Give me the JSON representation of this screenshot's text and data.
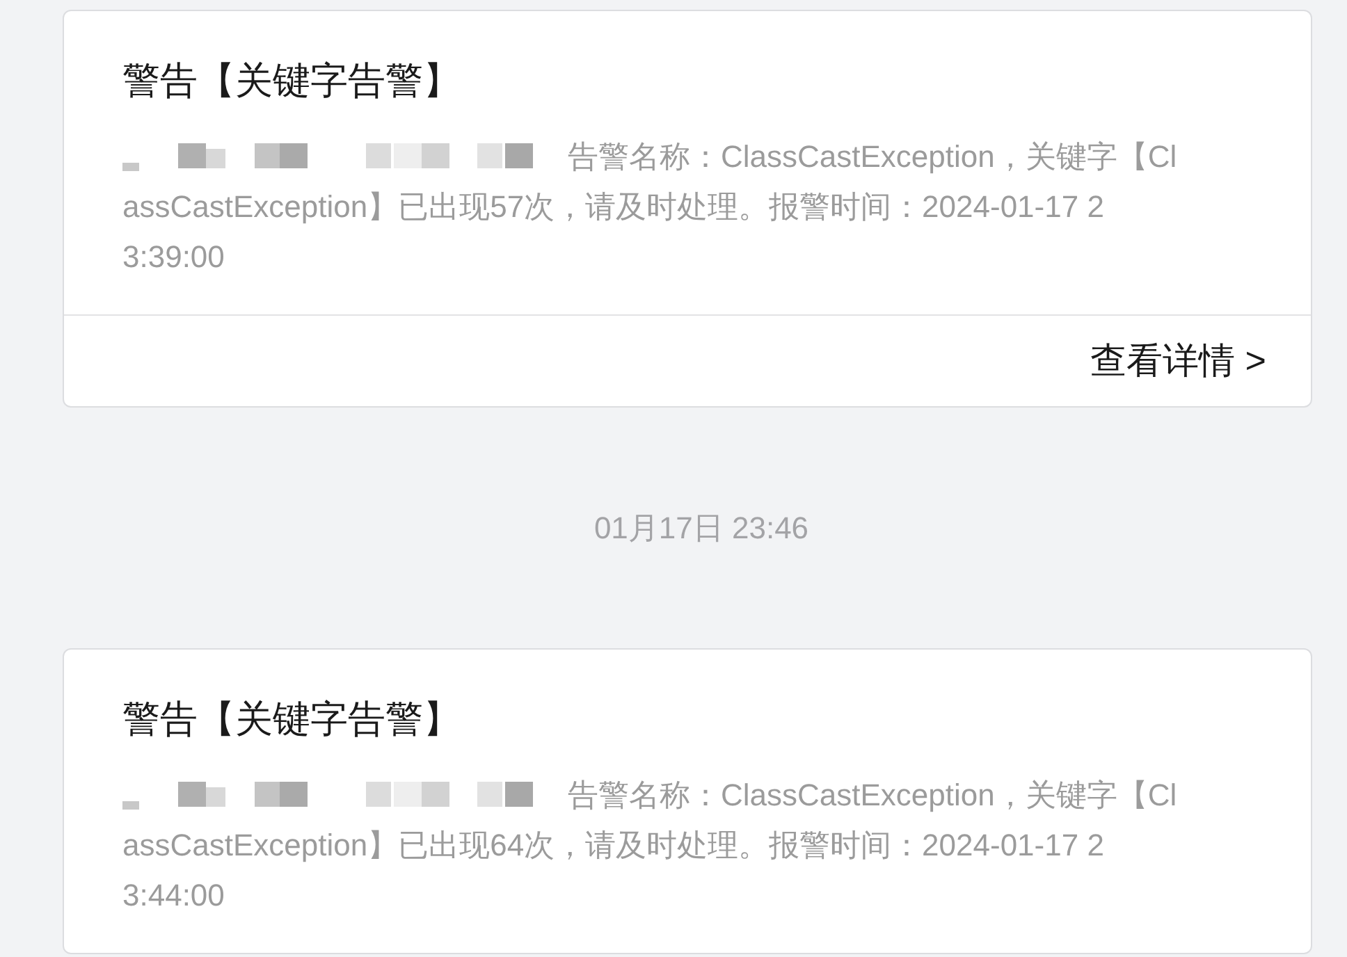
{
  "messages": [
    {
      "kind": "card",
      "title": "警告【关键字告警】",
      "body_lines": [
        "告警名称：ClassCastException，关键字【Cl",
        "assCastException】已出现57次，请及时处理。报警时间：2024-01-17 2",
        "3:39:00"
      ],
      "action": "查看详情 >"
    },
    {
      "kind": "time",
      "text": "01月17日 23:46"
    },
    {
      "kind": "card",
      "title": "警告【关键字告警】",
      "body_lines": [
        "告警名称：ClassCastException，关键字【Cl",
        "assCastException】已出现64次，请及时处理。报警时间：2024-01-17 2",
        "3:44:00"
      ]
    }
  ]
}
